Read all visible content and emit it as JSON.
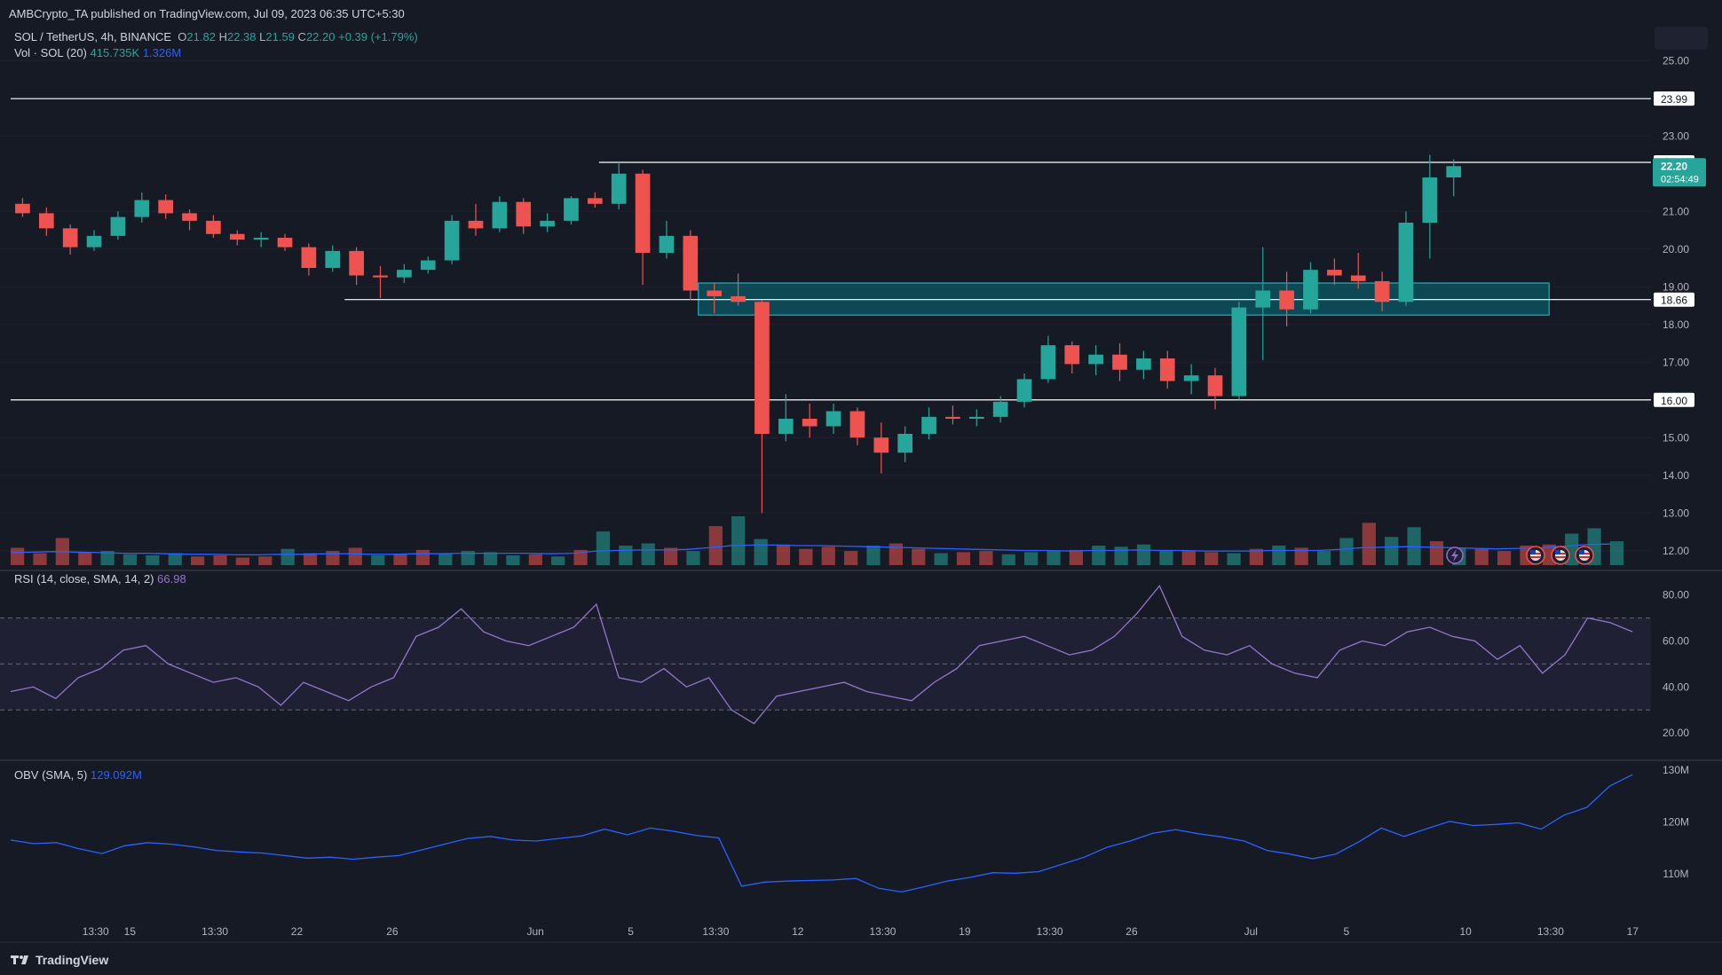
{
  "header": {
    "published": "AMBCrypto_TA published on TradingView.com, Jul 09, 2023 06:35 UTC+5:30",
    "symbol": "SOL / TetherUS, 4h, BINANCE",
    "ohlc": {
      "open_label": "O",
      "open": "21.82",
      "high_label": "H",
      "high": "22.38",
      "low_label": "L",
      "low": "21.59",
      "close_label": "C",
      "close": "22.20",
      "change": "+0.39 (+1.79%)"
    },
    "volume": {
      "label": "Vol · SOL (20)",
      "value": "415.735K",
      "ma": "1.326M"
    }
  },
  "rsi_legend": {
    "label": "RSI (14, close, SMA, 14, 2)",
    "value": "66.98"
  },
  "obv_legend": {
    "label": "OBV (SMA, 5)",
    "value": "129.092M"
  },
  "footer": {
    "brand": "TradingView"
  },
  "colors": {
    "up": "#26a69a",
    "down": "#ef5350",
    "zone": "#00838f",
    "rsi": "#9575cd",
    "obv": "#2962ff",
    "level": "#ffffff",
    "bg": "#161a25"
  },
  "icons": [
    "lightning-icon",
    "us-flag-icon",
    "us-flag-icon",
    "us-flag-icon"
  ],
  "chart_data": {
    "type": "candlestick",
    "timeframe": "4h",
    "price_axis": {
      "range": [
        11.5,
        25.9
      ],
      "ticks": [
        "25.00",
        "23.00",
        "21.00",
        "20.00",
        "19.00",
        "18.00",
        "17.00",
        "15.00",
        "14.00",
        "13.00",
        "12.00"
      ]
    },
    "price_labels": {
      "current": "22.20",
      "countdown": "02:54:49"
    },
    "time_axis": {
      "ticks": [
        {
          "label": "13:30",
          "time": "May 13 13:30"
        },
        {
          "label": "15",
          "time": "May 15"
        },
        {
          "label": "13:30",
          "time": "May 18 13:30"
        },
        {
          "label": "22",
          "time": "May 22"
        },
        {
          "label": "26",
          "time": "May 26"
        },
        {
          "label": "Jun",
          "time": "Jun 01"
        },
        {
          "label": "5",
          "time": "Jun 05"
        },
        {
          "label": "13:30",
          "time": "Jun 08 13:30"
        },
        {
          "label": "12",
          "time": "Jun 12"
        },
        {
          "label": "13:30",
          "time": "Jun 15 13:30"
        },
        {
          "label": "19",
          "time": "Jun 19"
        },
        {
          "label": "13:30",
          "time": "Jun 22 13:30"
        },
        {
          "label": "26",
          "time": "Jun 26"
        },
        {
          "label": "Jul",
          "time": "Jul 01"
        },
        {
          "label": "5",
          "time": "Jul 05"
        },
        {
          "label": "10",
          "time": "Jul 10"
        },
        {
          "label": "13:30",
          "time": "Jul 13 13:30"
        },
        {
          "label": "17",
          "time": "Jul 17"
        }
      ]
    },
    "levels": [
      {
        "price": 23.99,
        "label": "23.99",
        "start": "May 10"
      },
      {
        "price": 22.3,
        "label": "22.30",
        "start": "Jun 03 16:00"
      },
      {
        "price": 18.66,
        "label": "18.66",
        "start": "May 24 00:00"
      },
      {
        "price": 16.0,
        "label": "16.00",
        "start": "May 10"
      }
    ],
    "zone": {
      "low": 18.25,
      "high": 19.1,
      "from": "Jun 07 20:00",
      "to": "Jul 13 12:00"
    },
    "candles": [
      {
        "t": "May 10",
        "o": 21.2,
        "h": 21.35,
        "l": 20.85,
        "c": 20.95
      },
      {
        "t": "May 11",
        "o": 20.95,
        "h": 21.1,
        "l": 20.35,
        "c": 20.55
      },
      {
        "t": "May 12",
        "o": 20.55,
        "h": 20.65,
        "l": 19.85,
        "c": 20.05
      },
      {
        "t": "May 13",
        "o": 20.05,
        "h": 20.5,
        "l": 19.95,
        "c": 20.35
      },
      {
        "t": "May 14",
        "o": 20.35,
        "h": 21.0,
        "l": 20.25,
        "c": 20.85
      },
      {
        "t": "May 15",
        "o": 20.85,
        "h": 21.5,
        "l": 20.7,
        "c": 21.3
      },
      {
        "t": "May 16",
        "o": 21.3,
        "h": 21.45,
        "l": 20.8,
        "c": 20.95
      },
      {
        "t": "May 17",
        "o": 20.95,
        "h": 21.05,
        "l": 20.5,
        "c": 20.75
      },
      {
        "t": "May 18",
        "o": 20.75,
        "h": 20.9,
        "l": 20.3,
        "c": 20.4
      },
      {
        "t": "May 19",
        "o": 20.4,
        "h": 20.5,
        "l": 20.1,
        "c": 20.25
      },
      {
        "t": "May 20",
        "o": 20.25,
        "h": 20.45,
        "l": 20.05,
        "c": 20.3
      },
      {
        "t": "May 21",
        "o": 20.3,
        "h": 20.4,
        "l": 19.95,
        "c": 20.05
      },
      {
        "t": "May 22",
        "o": 20.05,
        "h": 20.15,
        "l": 19.3,
        "c": 19.5
      },
      {
        "t": "May 23",
        "o": 19.5,
        "h": 20.1,
        "l": 19.4,
        "c": 19.95
      },
      {
        "t": "May 24",
        "o": 19.95,
        "h": 20.05,
        "l": 19.05,
        "c": 19.3
      },
      {
        "t": "May 25",
        "o": 19.3,
        "h": 19.55,
        "l": 18.7,
        "c": 19.25
      },
      {
        "t": "May 26",
        "o": 19.25,
        "h": 19.6,
        "l": 19.1,
        "c": 19.45
      },
      {
        "t": "May 27",
        "o": 19.45,
        "h": 19.8,
        "l": 19.35,
        "c": 19.7
      },
      {
        "t": "May 28",
        "o": 19.7,
        "h": 20.9,
        "l": 19.6,
        "c": 20.75
      },
      {
        "t": "May 29",
        "o": 20.75,
        "h": 21.2,
        "l": 20.35,
        "c": 20.55
      },
      {
        "t": "May 30",
        "o": 20.55,
        "h": 21.4,
        "l": 20.45,
        "c": 21.25
      },
      {
        "t": "May 31",
        "o": 21.25,
        "h": 21.35,
        "l": 20.4,
        "c": 20.6
      },
      {
        "t": "Jun 01",
        "o": 20.6,
        "h": 20.95,
        "l": 20.45,
        "c": 20.75
      },
      {
        "t": "Jun 02",
        "o": 20.75,
        "h": 21.4,
        "l": 20.65,
        "c": 21.35
      },
      {
        "t": "Jun 03",
        "o": 21.35,
        "h": 21.5,
        "l": 21.1,
        "c": 21.2
      },
      {
        "t": "Jun 04",
        "o": 21.2,
        "h": 22.3,
        "l": 21.05,
        "c": 22.0
      },
      {
        "t": "Jun 05",
        "o": 22.0,
        "h": 22.1,
        "l": 19.05,
        "c": 19.9
      },
      {
        "t": "Jun 06",
        "o": 19.9,
        "h": 20.75,
        "l": 19.75,
        "c": 20.35
      },
      {
        "t": "Jun 07",
        "o": 20.35,
        "h": 20.5,
        "l": 18.65,
        "c": 18.9
      },
      {
        "t": "Jun 08",
        "o": 18.9,
        "h": 19.1,
        "l": 18.3,
        "c": 18.75
      },
      {
        "t": "Jun 09",
        "o": 18.75,
        "h": 19.35,
        "l": 18.5,
        "c": 18.6
      },
      {
        "t": "Jun 10",
        "o": 18.6,
        "h": 18.65,
        "l": 13.0,
        "c": 15.1
      },
      {
        "t": "Jun 11",
        "o": 15.1,
        "h": 16.15,
        "l": 14.9,
        "c": 15.5
      },
      {
        "t": "Jun 12",
        "o": 15.5,
        "h": 15.9,
        "l": 15.0,
        "c": 15.3
      },
      {
        "t": "Jun 13",
        "o": 15.3,
        "h": 15.9,
        "l": 15.1,
        "c": 15.7
      },
      {
        "t": "Jun 14",
        "o": 15.7,
        "h": 15.8,
        "l": 14.8,
        "c": 15.0
      },
      {
        "t": "Jun 15",
        "o": 15.0,
        "h": 15.4,
        "l": 14.05,
        "c": 14.6
      },
      {
        "t": "Jun 16",
        "o": 14.6,
        "h": 15.3,
        "l": 14.35,
        "c": 15.1
      },
      {
        "t": "Jun 17",
        "o": 15.1,
        "h": 15.8,
        "l": 14.95,
        "c": 15.55
      },
      {
        "t": "Jun 18",
        "o": 15.55,
        "h": 15.85,
        "l": 15.35,
        "c": 15.5
      },
      {
        "t": "Jun 19",
        "o": 15.5,
        "h": 15.75,
        "l": 15.3,
        "c": 15.55
      },
      {
        "t": "Jun 20",
        "o": 15.55,
        "h": 16.1,
        "l": 15.4,
        "c": 15.95
      },
      {
        "t": "Jun 21",
        "o": 15.95,
        "h": 16.7,
        "l": 15.8,
        "c": 16.55
      },
      {
        "t": "Jun 22",
        "o": 16.55,
        "h": 17.7,
        "l": 16.45,
        "c": 17.45
      },
      {
        "t": "Jun 23",
        "o": 17.45,
        "h": 17.55,
        "l": 16.7,
        "c": 16.95
      },
      {
        "t": "Jun 24",
        "o": 16.95,
        "h": 17.45,
        "l": 16.65,
        "c": 17.2
      },
      {
        "t": "Jun 25",
        "o": 17.2,
        "h": 17.5,
        "l": 16.5,
        "c": 16.8
      },
      {
        "t": "Jun 26",
        "o": 16.8,
        "h": 17.3,
        "l": 16.55,
        "c": 17.1
      },
      {
        "t": "Jun 27",
        "o": 17.1,
        "h": 17.3,
        "l": 16.3,
        "c": 16.5
      },
      {
        "t": "Jun 28",
        "o": 16.5,
        "h": 16.95,
        "l": 16.15,
        "c": 16.65
      },
      {
        "t": "Jun 29",
        "o": 16.65,
        "h": 16.85,
        "l": 15.75,
        "c": 16.1
      },
      {
        "t": "Jun 30",
        "o": 16.1,
        "h": 18.6,
        "l": 16.0,
        "c": 18.45
      },
      {
        "t": "Jul 01",
        "o": 18.45,
        "h": 20.05,
        "l": 17.05,
        "c": 18.9
      },
      {
        "t": "Jul 02",
        "o": 18.9,
        "h": 19.4,
        "l": 17.95,
        "c": 18.4
      },
      {
        "t": "Jul 03",
        "o": 18.4,
        "h": 19.65,
        "l": 18.3,
        "c": 19.45
      },
      {
        "t": "Jul 04",
        "o": 19.45,
        "h": 19.75,
        "l": 19.05,
        "c": 19.3
      },
      {
        "t": "Jul 05",
        "o": 19.3,
        "h": 19.9,
        "l": 18.95,
        "c": 19.15
      },
      {
        "t": "Jul 06",
        "o": 19.15,
        "h": 19.4,
        "l": 18.35,
        "c": 18.6
      },
      {
        "t": "Jul 07",
        "o": 18.6,
        "h": 21.0,
        "l": 18.5,
        "c": 20.7
      },
      {
        "t": "Jul 08",
        "o": 20.7,
        "h": 22.5,
        "l": 19.75,
        "c": 21.9
      },
      {
        "t": "Jul 09",
        "o": 21.9,
        "h": 22.38,
        "l": 21.4,
        "c": 22.2
      }
    ],
    "volume_ma_range": [
      0,
      3.0
    ],
    "rsi": {
      "range": [
        10,
        88
      ],
      "ticks": [
        "80.00",
        "60.00",
        "40.00",
        "20.00"
      ],
      "bands": [
        70,
        50,
        30
      ],
      "last": 66.98,
      "values": [
        38,
        40,
        35,
        44,
        48,
        56,
        58,
        50,
        46,
        42,
        44,
        40,
        32,
        42,
        38,
        34,
        40,
        44,
        62,
        66,
        74,
        64,
        60,
        58,
        62,
        66,
        76,
        44,
        42,
        48,
        40,
        44,
        30,
        24,
        36,
        38,
        40,
        42,
        38,
        36,
        34,
        42,
        48,
        58,
        60,
        62,
        58,
        54,
        56,
        62,
        72,
        84,
        62,
        56,
        54,
        58,
        50,
        46,
        44,
        56,
        60,
        58,
        64,
        66,
        62,
        60,
        52,
        58,
        46,
        54,
        70,
        68,
        64
      ]
    },
    "obv": {
      "range": [
        104,
        131
      ],
      "ticks": [
        "130M",
        "120M",
        "110M"
      ],
      "last": 129.092,
      "values": [
        116.5,
        115.8,
        116,
        114.8,
        113.9,
        115.4,
        116,
        115.7,
        115.2,
        114.5,
        114.2,
        114,
        113.5,
        113,
        113.2,
        112.8,
        113.2,
        113.5,
        114.6,
        115.7,
        116.8,
        117.2,
        116.5,
        116.3,
        116.8,
        117.3,
        118.6,
        117.5,
        118.8,
        118.2,
        117.4,
        116.9,
        107.6,
        108.4,
        108.6,
        108.7,
        108.8,
        109.1,
        107.2,
        106.5,
        107.5,
        108.6,
        109.3,
        110.2,
        110.1,
        110.4,
        111.8,
        113.2,
        115.1,
        116.3,
        117.8,
        118.5,
        117.7,
        117.1,
        116.3,
        114.5,
        113.8,
        112.9,
        113.8,
        116.1,
        118.8,
        117.2,
        118.7,
        120.1,
        119.3,
        119.5,
        119.8,
        118.6,
        121.3,
        122.8,
        126.9,
        129.1
      ]
    },
    "volume": [
      1.6,
      1.1,
      2.5,
      1.2,
      1.3,
      1.0,
      0.9,
      1.1,
      0.8,
      0.9,
      0.7,
      0.8,
      1.5,
      1.1,
      1.3,
      1.6,
      0.9,
      1.0,
      1.4,
      1.1,
      1.3,
      1.2,
      0.9,
      1.0,
      0.8,
      1.4,
      3.1,
      1.8,
      2.0,
      1.6,
      1.3,
      3.6,
      4.5,
      2.4,
      1.9,
      1.5,
      1.7,
      1.3,
      1.8,
      2.0,
      1.5,
      1.1,
      1.2,
      1.3,
      1.0,
      1.2,
      1.3,
      1.4,
      1.8,
      1.7,
      1.9,
      1.4,
      1.3,
      1.2,
      1.1,
      1.5,
      1.8,
      1.6,
      1.3,
      2.5,
      3.9,
      2.6,
      3.5,
      2.2,
      1.6,
      1.5,
      1.3,
      1.8,
      1.9,
      2.9,
      3.4,
      2.2
    ],
    "volume_ma": [
      1.15,
      1.2,
      1.25,
      1.2,
      1.15,
      1.1,
      1.1,
      1.05,
      1.0,
      1.0,
      0.95,
      0.95,
      1.0,
      1.0,
      1.05,
      1.05,
      1.0,
      1.0,
      1.05,
      1.05,
      1.1,
      1.1,
      1.1,
      1.1,
      1.05,
      1.1,
      1.3,
      1.35,
      1.4,
      1.4,
      1.45,
      1.6,
      1.8,
      1.85,
      1.85,
      1.8,
      1.8,
      1.75,
      1.7,
      1.65,
      1.6,
      1.55,
      1.5,
      1.45,
      1.4,
      1.35,
      1.35,
      1.3,
      1.35,
      1.35,
      1.4,
      1.35,
      1.35,
      1.3,
      1.3,
      1.3,
      1.35,
      1.35,
      1.35,
      1.45,
      1.6,
      1.65,
      1.7,
      1.65,
      1.6,
      1.55,
      1.5,
      1.55,
      1.6,
      1.75,
      1.9,
      1.95
    ]
  }
}
